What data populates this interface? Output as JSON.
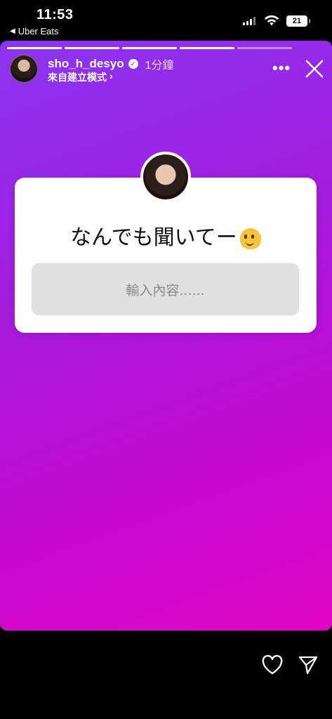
{
  "status_bar": {
    "time": "11:53",
    "back_app": "Uber Eats",
    "battery": "21"
  },
  "story": {
    "progress_segments": 5,
    "active_segments": 4,
    "username": "sho_h_desyo",
    "verified_mark": "✓",
    "time_ago": "1分鐘",
    "source_label": "來自建立模式",
    "source_chevron": "›",
    "more_label": "•••",
    "colors": {
      "gradient_start": "#8a36f0",
      "gradient_end": "#e006c4"
    }
  },
  "sticker": {
    "question": "なんでも聞いてー",
    "emoji_icon": "melting-face-icon",
    "input_placeholder": "輸入內容......"
  },
  "icons": {
    "header_avatar": "profile-avatar",
    "close": "close-icon",
    "like": "heart-icon",
    "send": "send-icon"
  }
}
